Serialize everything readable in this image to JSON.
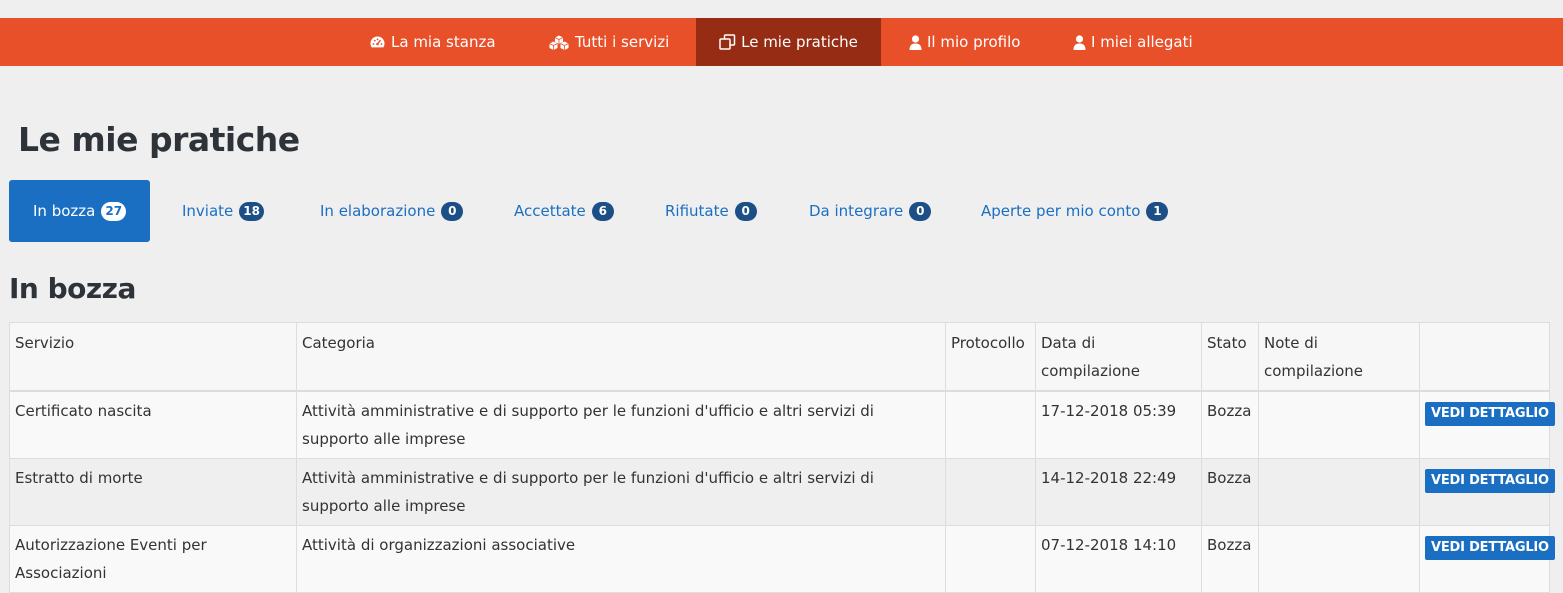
{
  "nav": {
    "items": [
      {
        "label": "La mia stanza",
        "icon": "dashboard-icon"
      },
      {
        "label": "Tutti i servizi",
        "icon": "cubes-icon"
      },
      {
        "label": "Le mie pratiche",
        "icon": "copy-icon",
        "active": true
      },
      {
        "label": "Il mio profilo",
        "icon": "user-icon"
      },
      {
        "label": "I miei allegati",
        "icon": "user-icon"
      }
    ]
  },
  "page_title": "Le mie pratiche",
  "tabs": [
    {
      "label": "In bozza",
      "count": "27",
      "active": true
    },
    {
      "label": "Inviate",
      "count": "18"
    },
    {
      "label": "In elaborazione",
      "count": "0"
    },
    {
      "label": "Accettate",
      "count": "6"
    },
    {
      "label": "Rifiutate",
      "count": "0"
    },
    {
      "label": "Da integrare",
      "count": "0"
    },
    {
      "label": "Aperte per mio conto",
      "count": "1"
    }
  ],
  "section_title": "In bozza",
  "table": {
    "headers": {
      "servizio": "Servizio",
      "categoria": "Categoria",
      "protocollo": "Protocollo",
      "data": "Data di compilazione",
      "stato": "Stato",
      "note": "Note di compilazione"
    },
    "rows": [
      {
        "servizio": "Certificato nascita",
        "categoria": "Attività amministrative e di supporto per le funzioni d'ufficio e altri servizi di supporto alle imprese",
        "protocollo": "",
        "data": "17-12-2018 05:39",
        "stato": "Bozza",
        "note": "",
        "action": "VEDI DETTAGLIO"
      },
      {
        "servizio": "Estratto di morte",
        "categoria": "Attività amministrative e di supporto per le funzioni d'ufficio e altri servizi di supporto alle imprese",
        "protocollo": "",
        "data": "14-12-2018 22:49",
        "stato": "Bozza",
        "note": "",
        "action": "VEDI DETTAGLIO"
      },
      {
        "servizio": "Autorizzazione Eventi per Associazioni",
        "categoria": "Attività di organizzazioni associative",
        "protocollo": "",
        "data": "07-12-2018 14:10",
        "stato": "Bozza",
        "note": "",
        "action": "VEDI DETTAGLIO"
      }
    ]
  },
  "colors": {
    "navbar": "#e8502a",
    "navbar_active": "#962c14",
    "primary": "#1b6fc2",
    "badge": "#1b4f85",
    "background": "#efefef"
  }
}
